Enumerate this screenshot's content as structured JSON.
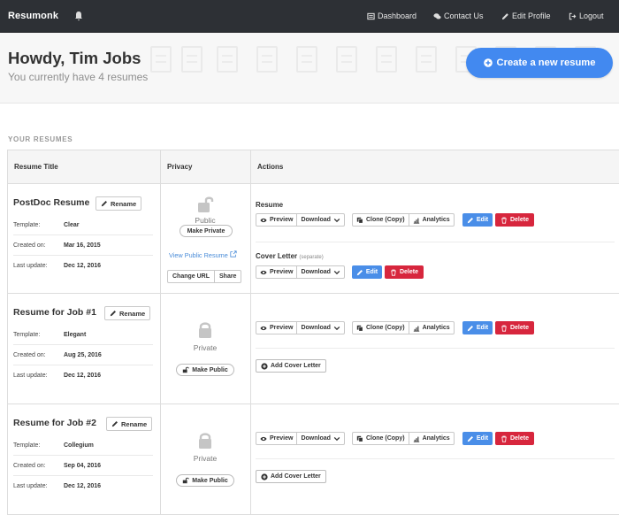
{
  "app": {
    "brand": "Resumonk"
  },
  "nav": {
    "dashboard": "Dashboard",
    "contact": "Contact Us",
    "edit_profile": "Edit Profile",
    "logout": "Logout"
  },
  "hero": {
    "greeting": "Howdy, Tim Jobs",
    "subtitle": "You currently have 4 resumes",
    "create_button": "Create a new resume"
  },
  "section_label": "YOUR RESUMES",
  "table": {
    "headers": [
      "Resume Title",
      "Privacy",
      "Actions"
    ]
  },
  "labels": {
    "rename": "Rename",
    "template": "Template:",
    "created_on": "Created on:",
    "last_update": "Last update:",
    "public": "Public",
    "private": "Private",
    "make_private": "Make Private",
    "make_public": "Make Public",
    "view_public": "View Public Resume",
    "change_url": "Change URL",
    "share": "Share",
    "resume": "Resume",
    "cover_letter": "Cover Letter",
    "separate": "(separate)",
    "preview": "Preview",
    "download": "Download",
    "clone": "Clone (Copy)",
    "analytics": "Analytics",
    "edit": "Edit",
    "delete": "Delete",
    "add_cover_letter": "Add Cover Letter"
  },
  "resumes": [
    {
      "title": "PostDoc Resume",
      "template": "Clear",
      "created": "Mar 16, 2015",
      "updated": "Dec 12, 2016",
      "privacy": "Public"
    },
    {
      "title": "Resume for Job #1",
      "template": "Elegant",
      "created": "Aug 25, 2016",
      "updated": "Dec 12, 2016",
      "privacy": "Private"
    },
    {
      "title": "Resume for Job #2",
      "template": "Collegium",
      "created": "Sep 04, 2016",
      "updated": "Dec 12, 2016",
      "privacy": "Private"
    }
  ],
  "colors": {
    "topbar": "#2d3035",
    "primary": "#4289f0",
    "edit": "#4a8ee8",
    "danger": "#d7263d"
  }
}
